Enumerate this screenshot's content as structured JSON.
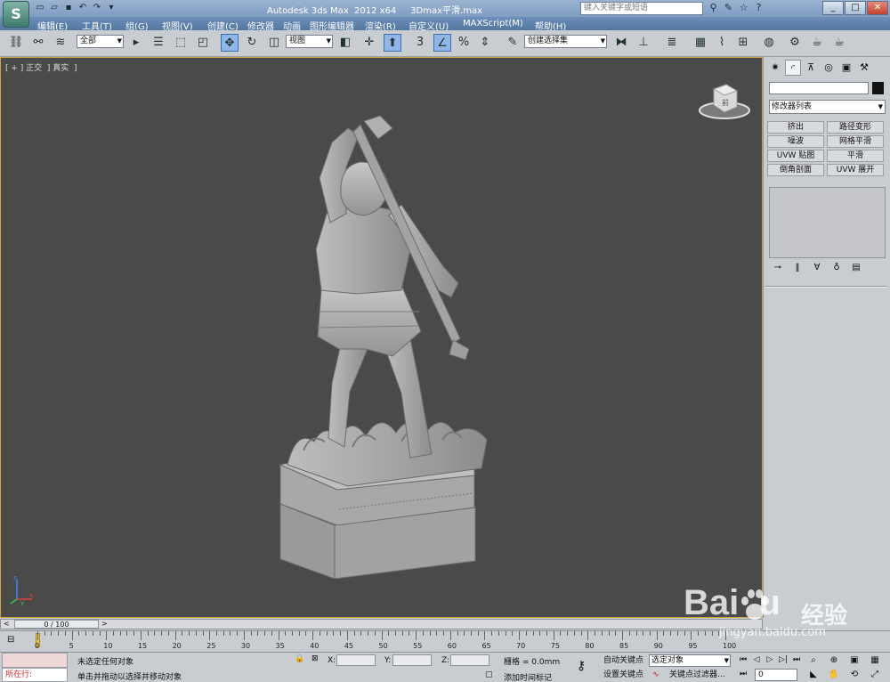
{
  "window": {
    "title": "Autodesk 3ds Max  2012 x64     3Dmax平滑.max",
    "search_placeholder": "键入关键字或短语",
    "logo_text": "S",
    "buttons": {
      "minimize": "_",
      "maximize": "□",
      "close": "✕"
    }
  },
  "quick_access": [
    "new-icon",
    "open-icon",
    "save-icon",
    "undo-icon",
    "redo-icon",
    "dropdown-icon"
  ],
  "title_tools": [
    "binoculars-icon",
    "tools-icon",
    "star-icon",
    "help-icon"
  ],
  "menu": [
    "编辑(E)",
    "工具(T)",
    "组(G)",
    "视图(V)",
    "创建(C)",
    "修改器",
    "动画",
    "图形编辑器",
    "渲染(R)",
    "自定义(U)",
    "MAXScript(M)",
    "帮助(H)"
  ],
  "toolbar": {
    "selection_filter": "全部",
    "coord_system": "视图",
    "named_selection": "创建选择集",
    "snap_label": "3"
  },
  "viewport": {
    "label": "[ + ] 正交  ] 真实  ]",
    "viewcube_label": "前",
    "axes": {
      "x": "x",
      "y": "y",
      "z": "z"
    }
  },
  "command_panel": {
    "tabs": [
      "create-icon",
      "modify-icon",
      "hierarchy-icon",
      "motion-icon",
      "display-icon",
      "utilities-icon"
    ],
    "modifier_list": "修改器列表",
    "modifier_buttons": [
      "挤出",
      "路径变形",
      "噪波",
      "网格平滑",
      "UVW 贴图",
      "平滑",
      "倒角剖面",
      "UVW 展开"
    ]
  },
  "time_slider": {
    "label": "0 / 100",
    "current": 0,
    "total": 100
  },
  "track": {
    "ticks": [
      0,
      5,
      10,
      15,
      20,
      25,
      30,
      35,
      40,
      45,
      50,
      55,
      60,
      65,
      70,
      75,
      80,
      85,
      90,
      95,
      100
    ]
  },
  "status": {
    "maxscript_prompt": "所在行:",
    "selection_text": "未选定任何对象",
    "prompt_text": "单击并拖动以选择并移动对象",
    "x_label": "X:",
    "y_label": "Y:",
    "z_label": "Z:",
    "grid_text": "栅格 = 0.0mm",
    "add_time_tag": "添加时间标记",
    "auto_key": "自动关键点",
    "set_key": "设置关键点",
    "key_filter_dropdown": "选定对象",
    "key_filters": "关键点过滤器...",
    "frame_value": "0"
  },
  "watermark": {
    "logo": "Bai  u",
    "brand": "经验",
    "url": "jingyan.baidu.com"
  }
}
